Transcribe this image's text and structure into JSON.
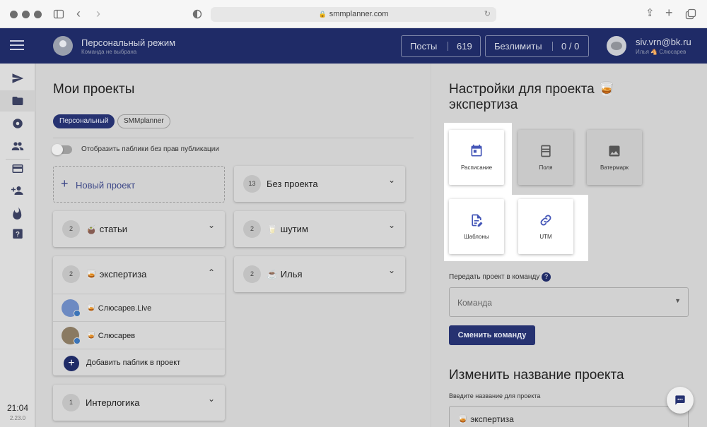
{
  "browser": {
    "url": "smmplanner.com"
  },
  "header": {
    "mode_title": "Персональный режим",
    "team_subtitle": "Команда не выбрана",
    "posts_label": "Посты",
    "posts_count": "619",
    "limits_label": "Безлимиты",
    "limits_count": "0 / 0",
    "user_email": "siv.vrn@bk.ru",
    "user_name": "Илья 🐴 Слюсарев"
  },
  "sidebar": {
    "time": "21:04",
    "version": "2.23.0"
  },
  "projects": {
    "title": "Мои проекты",
    "filters": [
      "Персональный",
      "SMMplanner"
    ],
    "toggle_label": "Отобразить паблики без прав публикации",
    "new_project": "Новый проект",
    "items": [
      {
        "count": "2",
        "name": "🧉 статьи"
      },
      {
        "count": "2",
        "name": "🥃 экспертиза"
      },
      {
        "count": "1",
        "name": "Интерлогика"
      },
      {
        "count": "13",
        "name": "Без проекта"
      },
      {
        "count": "2",
        "name": "🥛 шутим"
      },
      {
        "count": "2",
        "name": "☕ Илья"
      }
    ],
    "expanded_channels": [
      "🥃 Слюсарев.Live",
      "🥃 Слюсарев"
    ],
    "add_public": "Добавить паблик в проект"
  },
  "settings": {
    "title": "Настройки для проекта 🥃 экспертиза",
    "cards": [
      "Расписание",
      "Поля",
      "Ватермарк",
      "Шаблоны",
      "UTM"
    ],
    "transfer_label": "Передать проект в команду",
    "team_placeholder": "Команда",
    "change_team_button": "Сменить команду",
    "rename_title": "Изменить название проекта",
    "rename_label": "Введите название для проекта",
    "rename_value": "🥃 экспертиза"
  },
  "colors": {
    "header": "#1f2b67",
    "accent": "#4557b8",
    "button": "#263271"
  }
}
